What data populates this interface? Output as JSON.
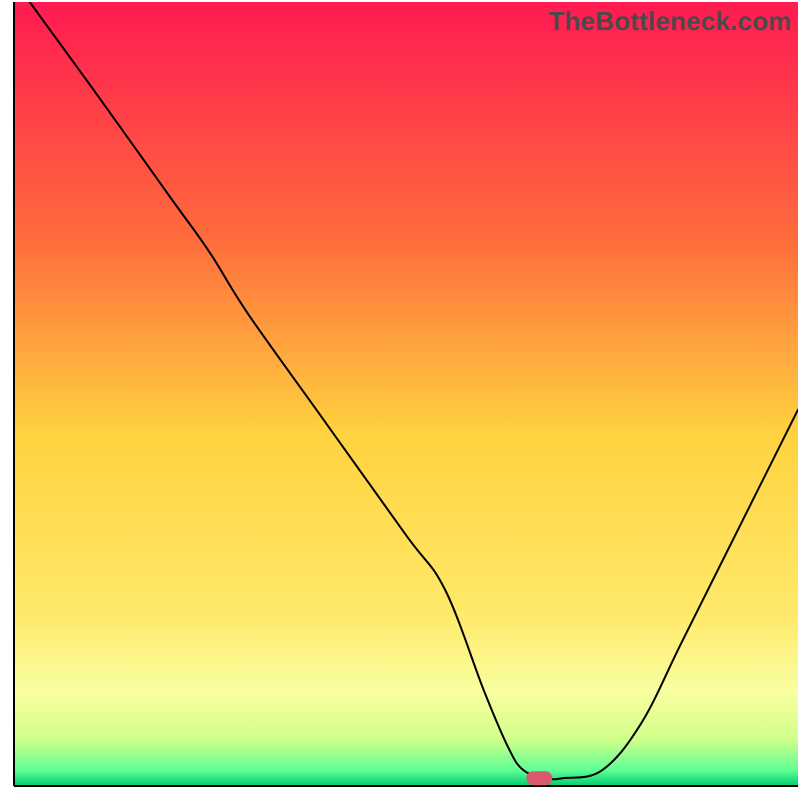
{
  "watermark": "TheBottleneck.com",
  "chart_data": {
    "type": "line",
    "title": "",
    "xlabel": "",
    "ylabel": "",
    "xlim": [
      0,
      100
    ],
    "ylim": [
      0,
      100
    ],
    "x": [
      2,
      10,
      20,
      25,
      30,
      40,
      50,
      55,
      60,
      63,
      65,
      68,
      70,
      75,
      80,
      85,
      90,
      95,
      100
    ],
    "values": [
      100,
      89,
      75,
      68,
      60,
      46,
      32,
      25,
      12,
      5,
      2,
      1,
      1,
      2,
      8,
      18,
      28,
      38,
      48
    ],
    "marker": {
      "x": 67,
      "y": 1
    },
    "gradient": {
      "stops": [
        {
          "offset": 0.0,
          "color": "#ff1a52"
        },
        {
          "offset": 0.3,
          "color": "#ff6b3c"
        },
        {
          "offset": 0.55,
          "color": "#ffd23f"
        },
        {
          "offset": 0.78,
          "color": "#ffe96a"
        },
        {
          "offset": 0.88,
          "color": "#f9ffa0"
        },
        {
          "offset": 0.94,
          "color": "#d1ff8a"
        },
        {
          "offset": 0.98,
          "color": "#5eff94"
        },
        {
          "offset": 1.0,
          "color": "#00cc70"
        }
      ]
    },
    "axes_visible": {
      "left": true,
      "bottom": true,
      "right": false,
      "top": false
    },
    "grid": false,
    "legend": false
  }
}
